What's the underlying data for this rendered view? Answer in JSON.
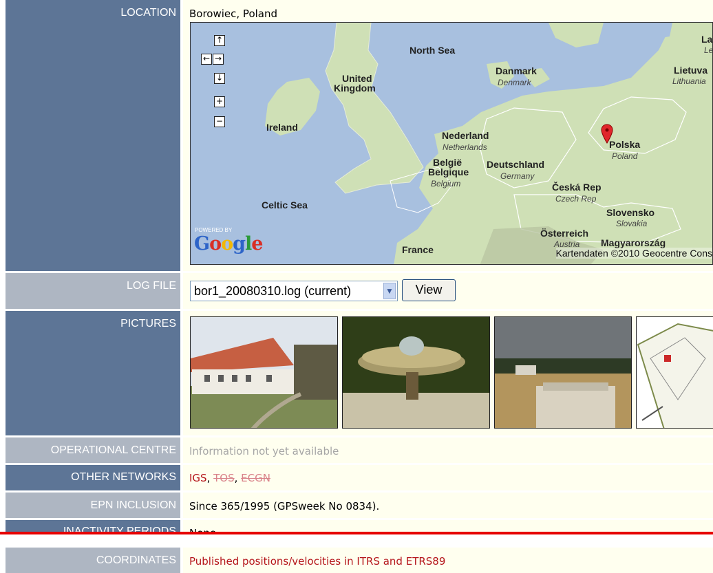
{
  "location": {
    "label": "LOCATION",
    "value": "Borowiec, Poland",
    "map": {
      "nav": {
        "up": "↑",
        "left": "←",
        "right": "→",
        "down": "↓",
        "zoom_in": "+",
        "zoom_out": "−"
      },
      "labels": {
        "north_sea": "North Sea",
        "uk_1": "United",
        "uk_2": "Kingdom",
        "ireland": "Ireland",
        "celtic_sea": "Celtic Sea",
        "danmark": "Danmark",
        "denmark": "Denmark",
        "lietuva": "Lietuva",
        "lithuania": "Lithuania",
        "la": "La",
        "le": "Le",
        "nederland": "Nederland",
        "netherlands": "Netherlands",
        "belgie": "België",
        "belgique": "Belgique",
        "belgium": "Belgium",
        "deutschland": "Deutschland",
        "germany": "Germany",
        "polska": "Polska",
        "poland": "Poland",
        "ceska": "Česká Rep",
        "czech": "Czech Rep",
        "slovensko": "Slovensko",
        "slovakia": "Slovakia",
        "osterreich": "Österreich",
        "austria": "Austria",
        "magyarorszag": "Magyarország",
        "france": "France"
      },
      "powered_by": "POWERED BY",
      "google": [
        "G",
        "o",
        "o",
        "g",
        "l",
        "e"
      ],
      "copyright": "Kartendaten ©2010 Geocentre Cons"
    }
  },
  "log_file": {
    "label": "LOG FILE",
    "selected": "bor1_20080310.log (current)",
    "button": "View"
  },
  "pictures": {
    "label": "PICTURES"
  },
  "operational_centre": {
    "label": "OPERATIONAL CENTRE",
    "value": "Information not yet available"
  },
  "other_networks": {
    "label": "OTHER NETWORKS",
    "igs": "IGS",
    "sep1": ", ",
    "tos": "TOS",
    "sep2": ", ",
    "ecgn": "ECGN"
  },
  "epn_inclusion": {
    "label": "EPN INCLUSION",
    "value": "Since 365/1995 (GPSweek No 0834)."
  },
  "inactivity": {
    "label": "INACTIVITY PERIODS",
    "value": "None"
  },
  "coordinates": {
    "label": "COORDINATES",
    "value": "Published positions/velocities in ITRS and ETRS89"
  },
  "colors": {
    "label_dark": "#5d7596",
    "label_light": "#aeb6c2",
    "value_bg": "#ffffef",
    "link_red": "#b5161b",
    "annotation_line": "#e60000"
  }
}
